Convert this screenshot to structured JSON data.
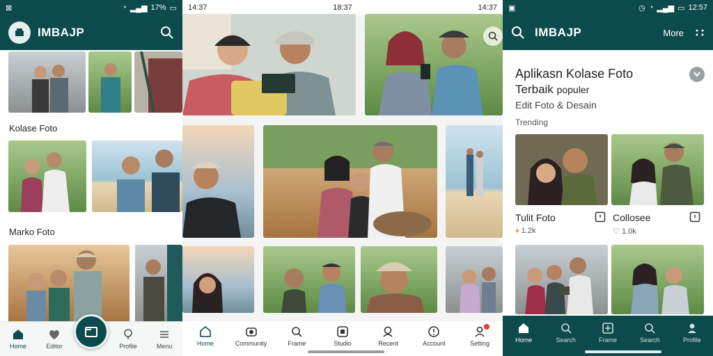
{
  "panel1": {
    "status": {
      "time": "",
      "battery": "17%"
    },
    "appbar": {
      "title": "IMBAJP"
    },
    "sections": [
      {
        "title": "Kolase Foto"
      },
      {
        "title": "Marko Foto"
      }
    ],
    "nav": [
      {
        "label": "Home",
        "icon": "home-icon"
      },
      {
        "label": "Editor",
        "icon": "heart-icon"
      },
      {
        "label": "",
        "icon": "collage-icon"
      },
      {
        "label": "Profile",
        "icon": "search-person-icon"
      },
      {
        "label": "Menu",
        "icon": "menu-icon"
      }
    ]
  },
  "panel2": {
    "status": {
      "left": "14:37",
      "center": "18:37",
      "right": "14:37"
    },
    "nav": [
      {
        "label": "Home",
        "icon": "home-icon"
      },
      {
        "label": "Community",
        "icon": "camera-icon"
      },
      {
        "label": "Frame",
        "icon": "search-icon"
      },
      {
        "label": "Studio",
        "icon": "grid-icon"
      },
      {
        "label": "Recent",
        "icon": "person-search-icon"
      },
      {
        "label": "Account",
        "icon": "alert-icon"
      },
      {
        "label": "Setting",
        "icon": "profile-icon"
      }
    ]
  },
  "panel3": {
    "status": {
      "time": "12:57"
    },
    "appbar": {
      "title": "IMBAJP",
      "more": "More"
    },
    "heading": {
      "line1": "Aplikasn Kolase Foto",
      "line2": "Terbaik",
      "line2b": "populer",
      "line3": "Edit Foto & Desain"
    },
    "trending": "Trending",
    "cards": [
      {
        "title": "Tulit Foto",
        "meta": "1.2k"
      },
      {
        "title": "Collosee",
        "meta": "1.0k"
      }
    ],
    "nav": [
      {
        "label": "Home",
        "icon": "home-icon"
      },
      {
        "label": "Search",
        "icon": "search-icon"
      },
      {
        "label": "Frame",
        "icon": "frame-icon"
      },
      {
        "label": "Search",
        "icon": "search-icon"
      },
      {
        "label": "Profile",
        "icon": "profile-icon"
      }
    ]
  },
  "colors": {
    "brand": "#0c4a4c",
    "notify": "#e53935"
  }
}
